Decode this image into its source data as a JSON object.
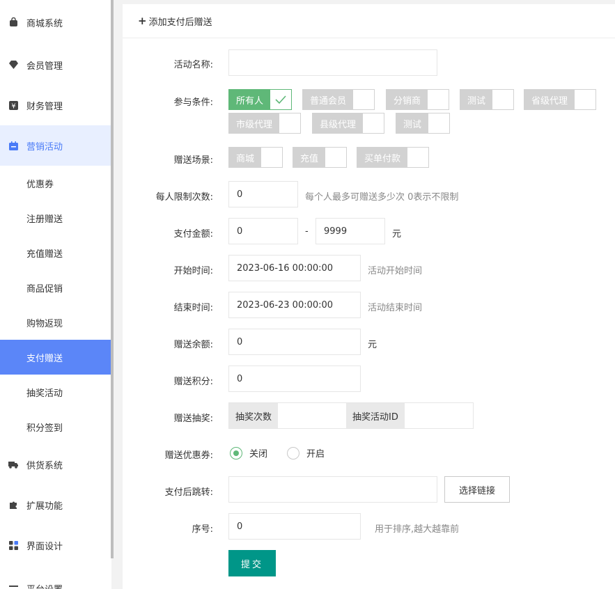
{
  "sidebar": {
    "items": [
      {
        "label": "商城系统",
        "icon": "bag-icon"
      },
      {
        "label": "会员管理",
        "icon": "diamond-icon"
      },
      {
        "label": "财务管理",
        "icon": "yen-icon"
      },
      {
        "label": "营销活动",
        "icon": "calendar-icon"
      }
    ],
    "sub_items": [
      "优惠券",
      "注册赠送",
      "充值赠送",
      "商品促销",
      "购物返现",
      "支付赠送",
      "抽奖活动",
      "积分签到"
    ],
    "active_sub": "支付赠送",
    "items_after": [
      {
        "label": "供货系统",
        "icon": "truck-icon"
      },
      {
        "label": "扩展功能",
        "icon": "puzzle-icon"
      },
      {
        "label": "界面设计",
        "icon": "layout-icon"
      }
    ],
    "cut_label": "平台设置"
  },
  "header": {
    "title": "添加支付后赠送"
  },
  "form": {
    "name_label": "活动名称:",
    "name_value": "",
    "cond_label": "参与条件:",
    "conditions": [
      {
        "label": "所有人",
        "checked": true
      },
      {
        "label": "普通会员",
        "checked": false
      },
      {
        "label": "分销商",
        "checked": false
      },
      {
        "label": "测试",
        "checked": false
      },
      {
        "label": "省级代理",
        "checked": false
      },
      {
        "label": "市级代理",
        "checked": false
      },
      {
        "label": "县级代理",
        "checked": false
      },
      {
        "label": "测试",
        "checked": false
      }
    ],
    "scene_label": "赠送场景:",
    "scenes": [
      "商城",
      "充值",
      "买单付款"
    ],
    "limit_label": "每人限制次数:",
    "limit_value": "0",
    "limit_hint": "每个人最多可赠送多少次 0表示不限制",
    "pay_label": "支付金额:",
    "pay_min": "0",
    "pay_sep": "-",
    "pay_max": "9999",
    "pay_unit": "元",
    "start_label": "开始时间:",
    "start_value": "2023-06-16 00:00:00",
    "start_hint": "活动开始时间",
    "end_label": "结束时间:",
    "end_value": "2023-06-23 00:00:00",
    "end_hint": "活动结束时间",
    "money_label": "赠送余额:",
    "money_value": "0",
    "money_unit": "元",
    "score_label": "赠送积分:",
    "score_value": "0",
    "lottery_label": "赠送抽奖:",
    "lottery_count_addon": "抽奖次数",
    "lottery_id_addon": "抽奖活动ID",
    "coupon_label": "赠送优惠券:",
    "coupon_off": "关闭",
    "coupon_on": "开启",
    "jump_label": "支付后跳转:",
    "jump_value": "",
    "jump_button": "选择链接",
    "sort_label": "序号:",
    "sort_value": "0",
    "sort_hint": "用于排序,越大越靠前",
    "submit": "提交"
  },
  "colors": {
    "accent": "#5b86f8",
    "check": "#5fb878",
    "submit": "#009688"
  }
}
